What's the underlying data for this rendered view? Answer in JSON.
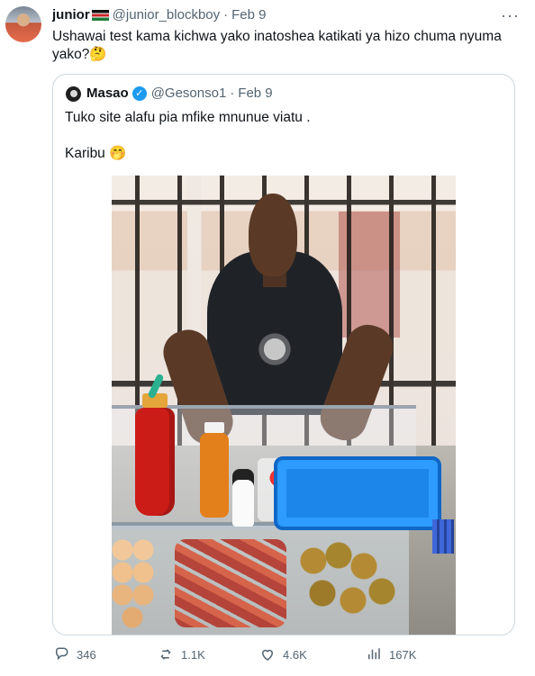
{
  "tweet": {
    "author_name": "junior",
    "author_handle": "@junior_blockboy",
    "date_sep": "·",
    "date": "Feb 9",
    "text_line_1": "Ushawai test kama kichwa yako inatoshea katikati ya hizo chuma nyuma",
    "text_line_2": "yako?🤔",
    "more_label": "···"
  },
  "quote": {
    "author_name": "Masao",
    "author_handle": "@Gesonso1",
    "date_sep": "·",
    "date": "Feb 9",
    "text_line_1": "Tuko site alafu pia mfike mnunue viatu .",
    "text_line_2": "Karibu 🤭"
  },
  "actions": {
    "reply_count": "346",
    "repost_count": "1.1K",
    "like_count": "4.6K",
    "views_count": "167K"
  },
  "icons": {
    "reply": "reply-icon",
    "repost": "repost-icon",
    "like": "heart-icon",
    "views": "views-icon",
    "bookmark": "bookmark-icon",
    "share": "share-icon"
  },
  "colors": {
    "text": "#0f1419",
    "muted": "#536471",
    "border": "#cfd9de",
    "verified": "#1d9bf0"
  }
}
